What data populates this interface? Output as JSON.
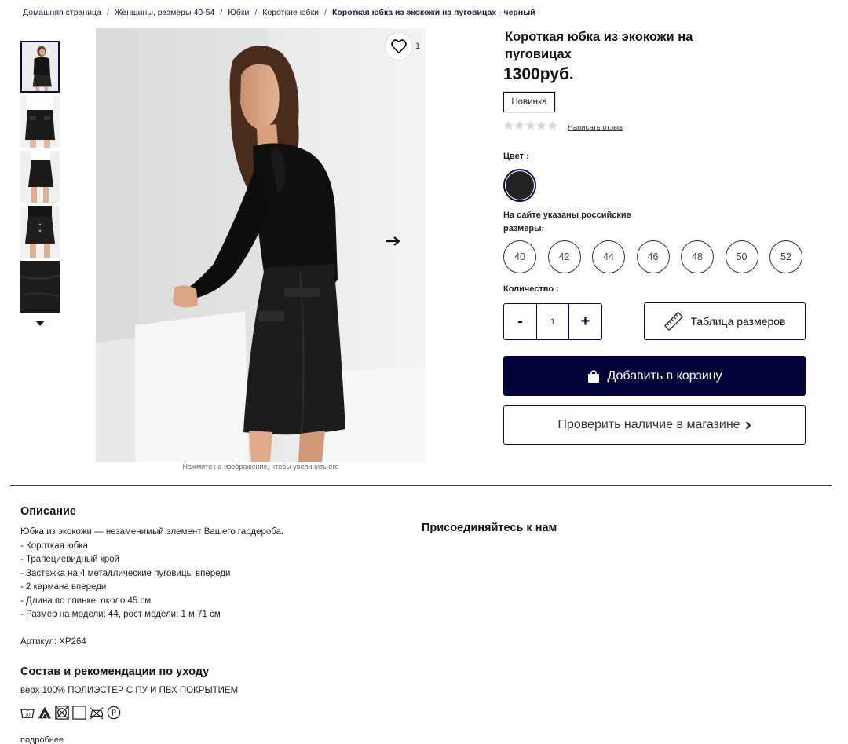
{
  "breadcrumb": {
    "items": [
      "Домашняя страница",
      "Женщины, размеры 40-54",
      "Юбки",
      "Короткие юбки"
    ],
    "current": "Короткая юбка из экокожи на пуговицах - черный",
    "separator": "/"
  },
  "gallery": {
    "favorite_count": "1",
    "zoom_hint": "Нажмите на изображение, чтобы увеличить его",
    "thumbnail_count": 5
  },
  "product": {
    "title": "Короткая юбка из экокожи на пуговицах",
    "price": "1300руб.",
    "badge": "Новинка",
    "rating": 0,
    "review_link": "Написать отзыв",
    "color_label": "Цвет :",
    "selected_color": "#222222",
    "size_note": "На сайте указаны российские размеры:",
    "sizes": [
      "40",
      "42",
      "44",
      "46",
      "48",
      "50",
      "52"
    ],
    "quantity_label": "Количество :",
    "quantity": "1",
    "minus": "-",
    "plus": "+",
    "size_table_label": "Таблица размеров",
    "add_to_cart": "Добавить в корзину",
    "check_store": "Проверить наличие в магазине"
  },
  "description": {
    "heading": "Описание",
    "lines": [
      "Юбка из экокожи — незаменимый элемент Вашего гардероба.",
      "- Короткая юбка",
      "- Трапециевидный крой",
      "- Застежка на 4 металлические пуговицы впереди",
      "- 2 кармана впереди",
      "- Длина по спинке: около 45 см",
      "- Размер на модели: 44, рост модели: 1 м 71 см"
    ],
    "sku": "Артикул: XP264"
  },
  "social": {
    "heading": "Присоединяйтесь к нам"
  },
  "care": {
    "heading": "Состав и рекомендации по уходу",
    "composition": "верх 100% ПОЛИЭСТЕР С ПУ И ПВХ ПОКРЫТИЕМ",
    "icons": [
      "wash-30-icon",
      "bleach-icon",
      "no-tumble-dry-icon",
      "dry-flat-icon",
      "iron-icon",
      "dry-clean-p-icon"
    ],
    "more_link": "подробнее"
  },
  "colors": {
    "accent": "#03033a",
    "border": "#0b0b4a"
  }
}
